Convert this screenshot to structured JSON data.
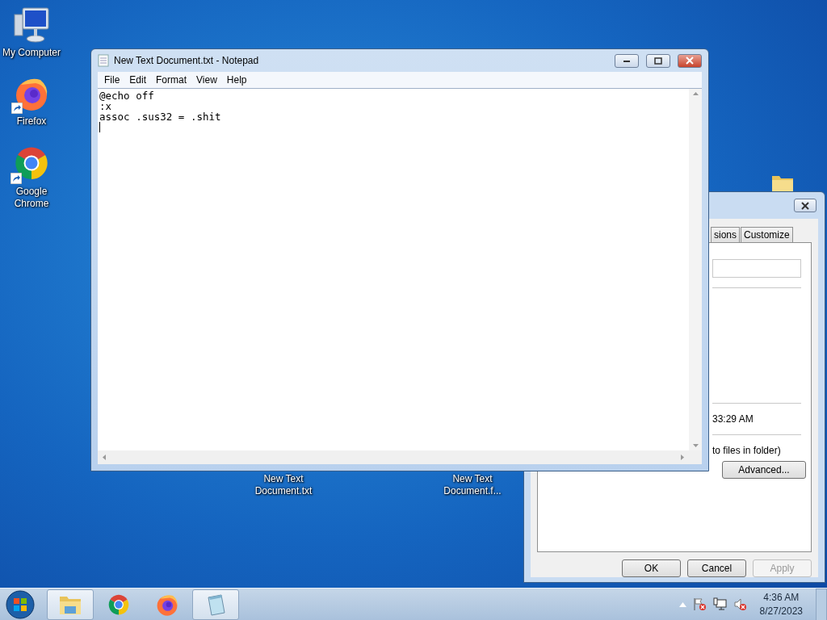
{
  "desktop": {
    "icons": [
      {
        "kind": "computer",
        "label": "My Computer",
        "shortcut": false
      },
      {
        "kind": "firefox",
        "label": "Firefox",
        "shortcut": true
      },
      {
        "kind": "chrome",
        "label": "Google Chrome",
        "shortcut": true
      }
    ],
    "files": [
      {
        "label": "New Text Document.txt"
      },
      {
        "label": "New Text Document.f..."
      }
    ]
  },
  "notepad": {
    "title": "New Text Document.txt - Notepad",
    "menu": [
      "File",
      "Edit",
      "Format",
      "View",
      "Help"
    ],
    "lines": [
      "@echo off",
      ":x",
      "assoc .sus32 = .shit"
    ]
  },
  "properties_dialog": {
    "tabs": [
      {
        "label": "sions",
        "selected": false
      },
      {
        "label": "Customize",
        "selected": false
      }
    ],
    "modified_time": "33:29 AM",
    "attributes_note": "to files in folder)",
    "advanced_button": "Advanced...",
    "buttons": [
      {
        "label": "OK",
        "disabled": false
      },
      {
        "label": "Cancel",
        "disabled": false
      },
      {
        "label": "Apply",
        "disabled": true
      }
    ]
  },
  "taskbar": {
    "items": [
      {
        "kind": "explorer",
        "open": true
      },
      {
        "kind": "chrome",
        "open": false
      },
      {
        "kind": "firefox",
        "open": false
      },
      {
        "kind": "notepad",
        "open": true
      }
    ],
    "tray": [
      {
        "kind": "flag"
      },
      {
        "kind": "network"
      },
      {
        "kind": "volume"
      }
    ],
    "time": "4:36 AM",
    "date": "8/27/2023"
  }
}
